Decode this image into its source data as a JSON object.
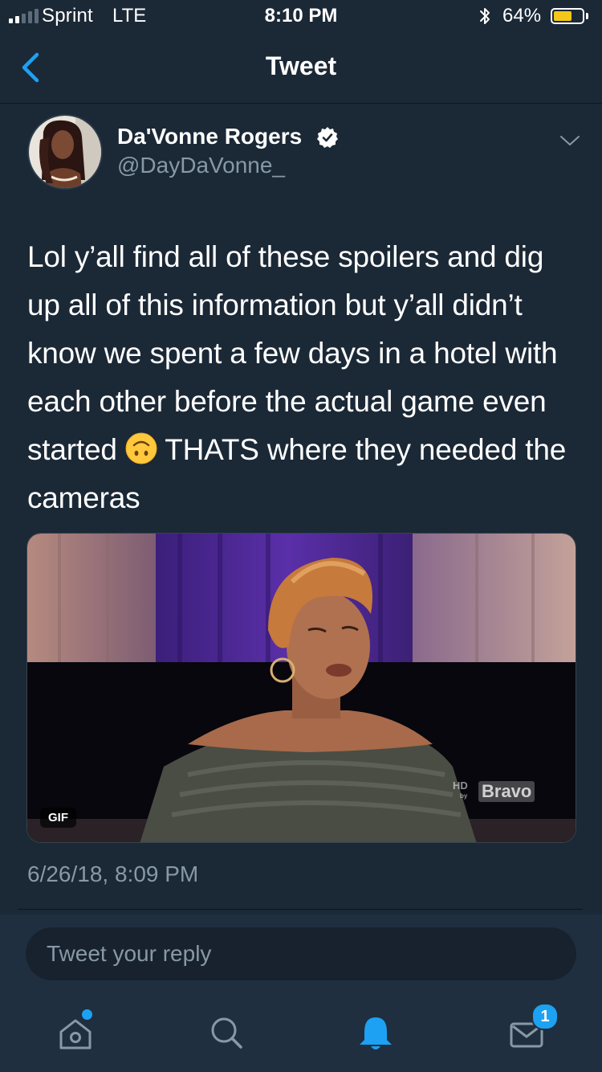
{
  "status_bar": {
    "carrier": "Sprint",
    "network": "LTE",
    "time": "8:10 PM",
    "battery_percent": "64%",
    "battery_level": 0.64,
    "signal_bars": 2
  },
  "nav": {
    "title": "Tweet",
    "back_icon": "chevron-left-icon"
  },
  "tweet": {
    "display_name": "Da'Vonne Rogers",
    "handle": "@DayDaVonne_",
    "verified": true,
    "text_before_emoji": "Lol y’all find all of these spoilers and dig up all of this information but y’all didn’t know we spent a few days in a hotel with each other before the actual game even started ",
    "emoji": "upside-down-face-emoji",
    "text_after_emoji": " THATS where they needed the cameras",
    "media": {
      "badge": "GIF",
      "watermark_hd": "HD",
      "watermark_by": "by",
      "watermark_brand": "Bravo"
    },
    "timestamp": "6/26/18, 8:09 PM"
  },
  "reply": {
    "placeholder": "Tweet your reply"
  },
  "tab_bar": {
    "tabs": [
      {
        "icon": "home-icon",
        "has_dot": true
      },
      {
        "icon": "search-icon"
      },
      {
        "icon": "bell-icon",
        "active": true
      },
      {
        "icon": "mail-icon",
        "badge": "1"
      }
    ]
  },
  "colors": {
    "background": "#1b2836",
    "accent": "#1da1f2",
    "secondary_text": "#8899a6",
    "battery": "#f4c81a"
  }
}
